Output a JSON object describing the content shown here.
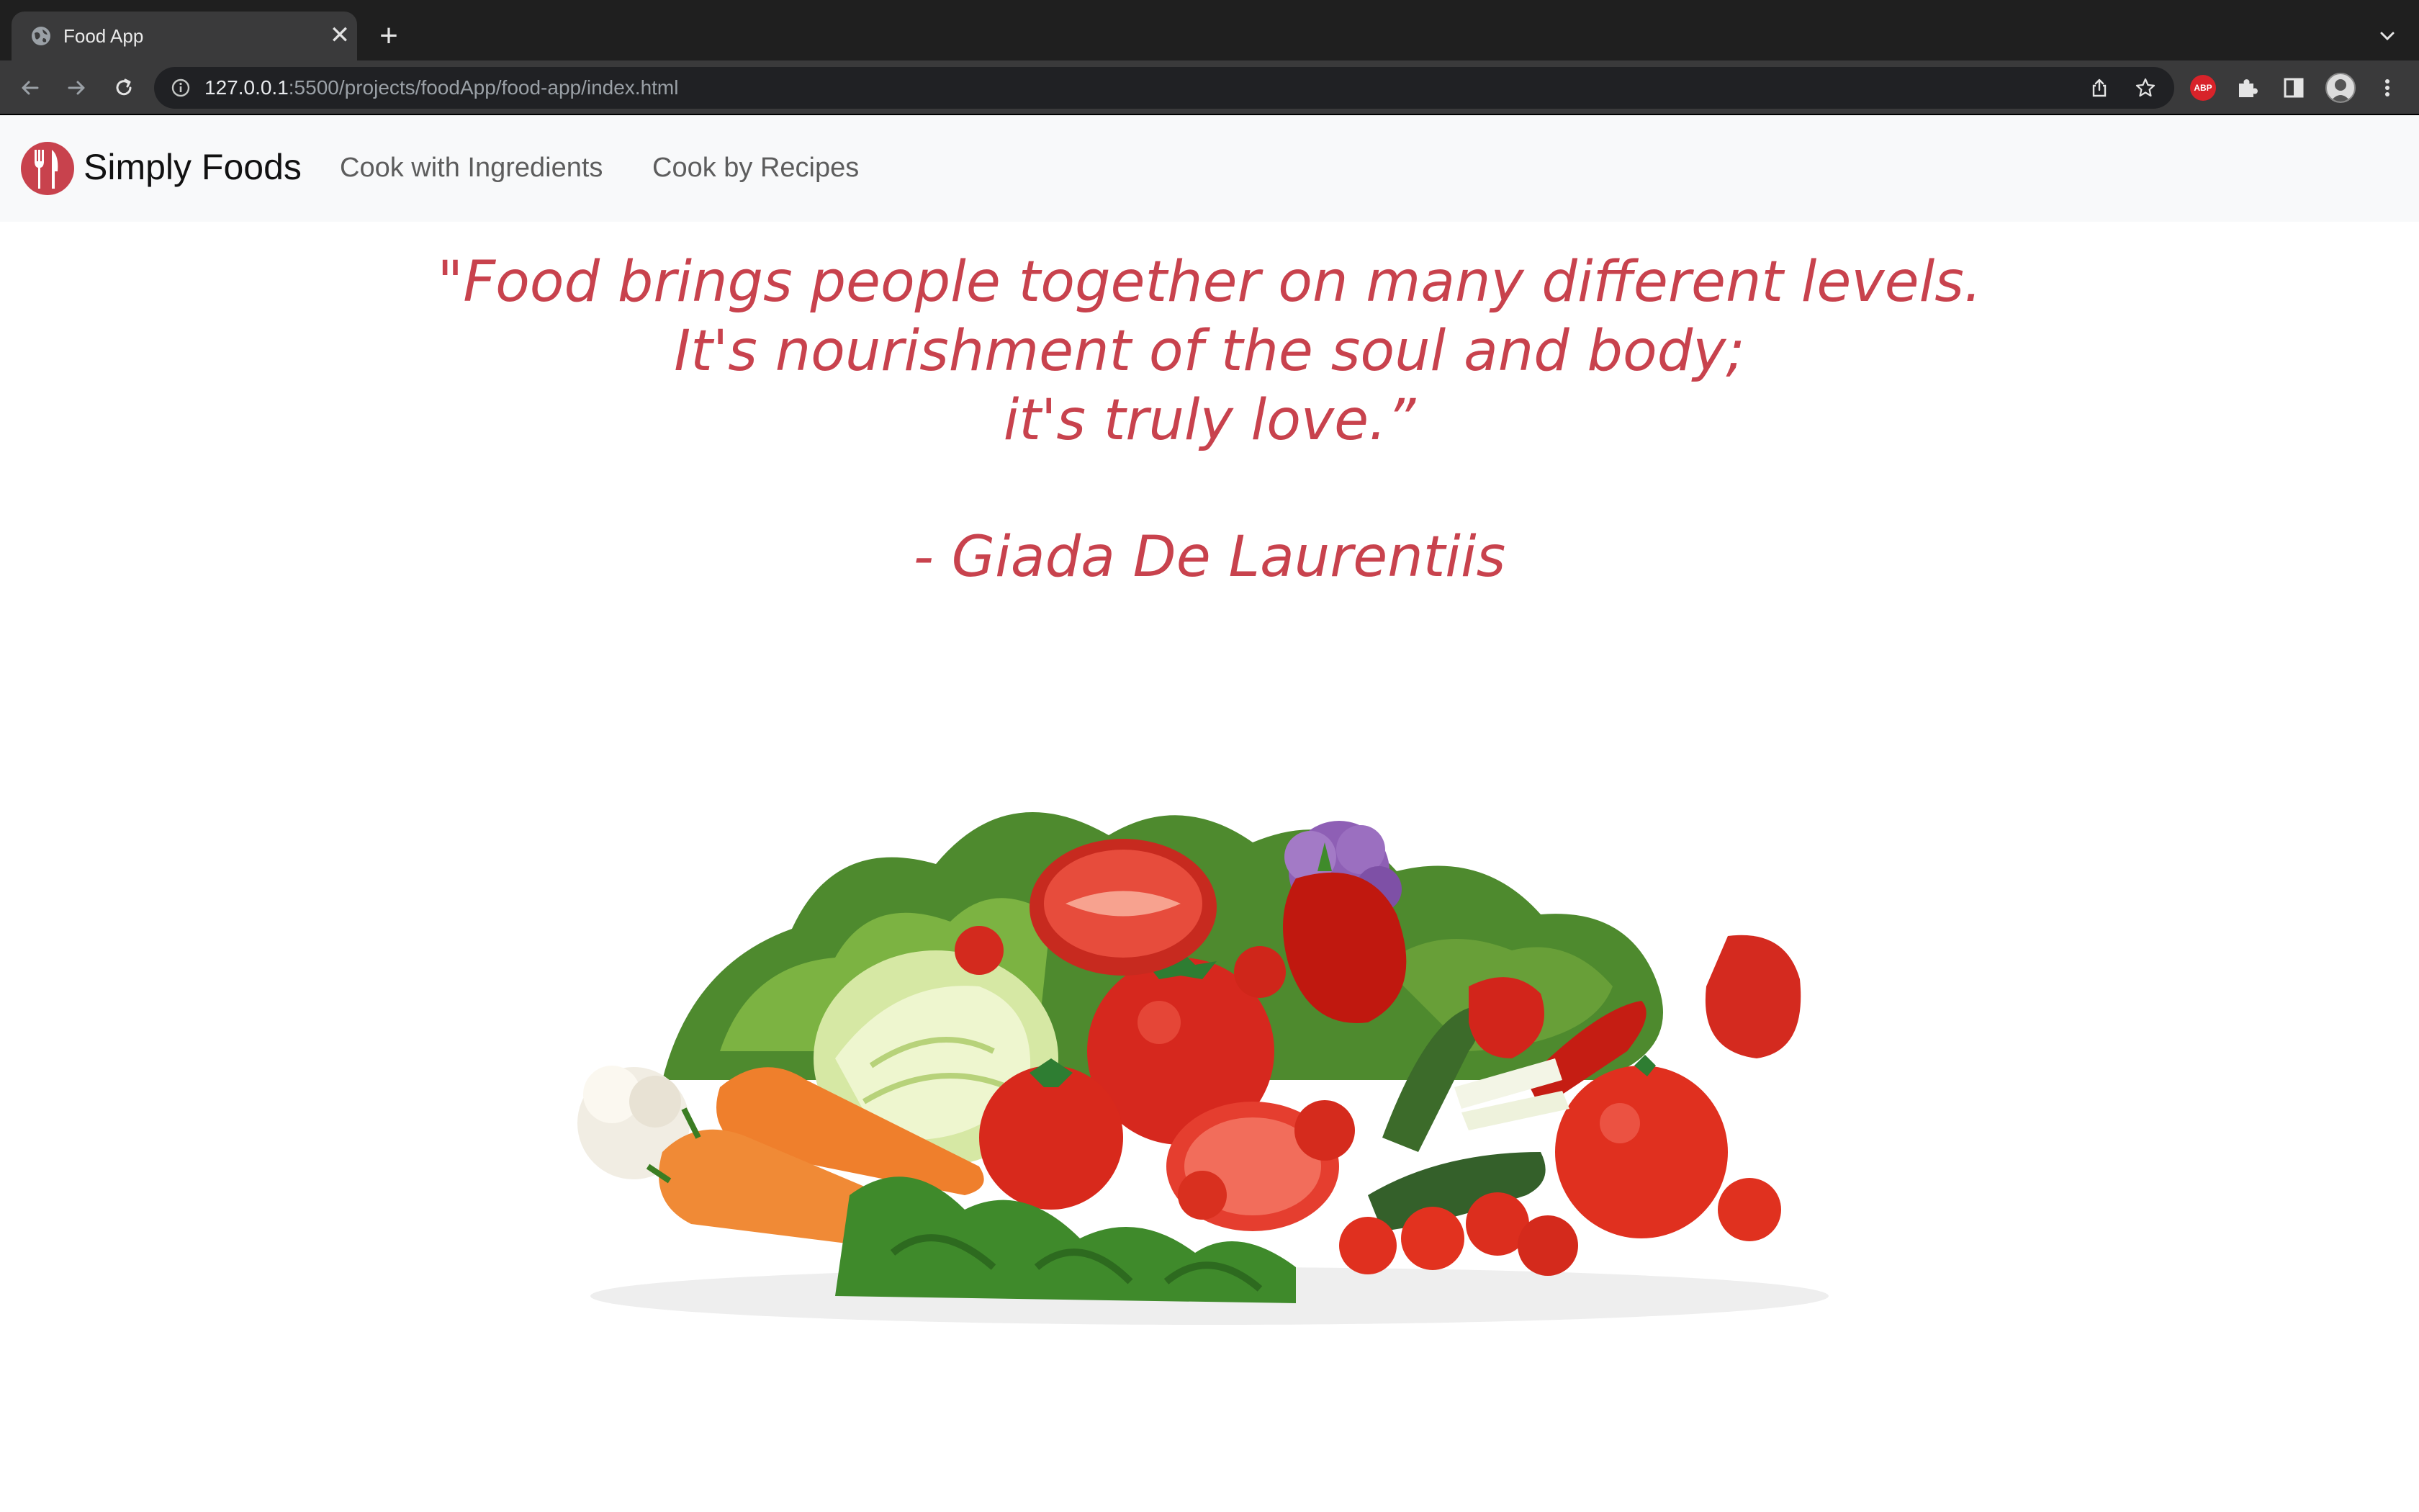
{
  "browser": {
    "tab_title": "Food App",
    "url_host": "127.0.0.1",
    "url_rest": ":5500/projects/foodApp/food-app/index.html",
    "adblock_badge": "ABP"
  },
  "navbar": {
    "brand": "Simply Foods",
    "links": [
      "Cook with Ingredients",
      "Cook by Recipes"
    ]
  },
  "quote": {
    "lines": [
      "\"Food brings people together on many different levels.",
      "It's nourishment of the soul and body;",
      "it's truly love.”"
    ],
    "author": "- Giada De Laurentiis"
  },
  "colors": {
    "accent": "#c8424d",
    "navbar_bg": "#f8f9fa"
  },
  "hero_image": "vegetables-pile"
}
